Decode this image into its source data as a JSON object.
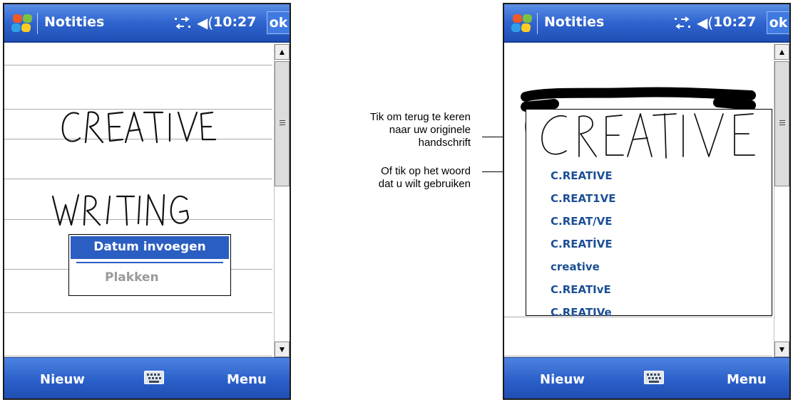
{
  "device_left": {
    "title": "Notities",
    "time": "10:27",
    "ok_label": "ok",
    "context_menu": {
      "items": [
        {
          "label": "Datum invoegen",
          "state": "active"
        },
        {
          "label": "Plakken",
          "state": "disabled"
        }
      ]
    },
    "menubar": {
      "left_label": "Nieuw",
      "right_label": "Menu"
    }
  },
  "device_right": {
    "title": "Notities",
    "time": "10:27",
    "ok_label": "ok",
    "alternatives": [
      "C.REATIVE",
      "C.REAT1VE",
      "C.REAT/VE",
      "C.REATİVE",
      "creative",
      "C.REATIvE",
      "C.REATIVe"
    ],
    "menubar": {
      "left_label": "Nieuw",
      "right_label": "Menu"
    }
  },
  "callouts": [
    {
      "lines": [
        "Tik om terug te keren",
        "naar uw originele",
        "handschrift"
      ]
    },
    {
      "lines": [
        "Of tik op het woord",
        "dat u wilt gebruiken"
      ]
    }
  ],
  "colors": {
    "titlebar": "#2f64cf",
    "menu_highlight": "#2b5ec2",
    "alternative_text": "#1c4f95",
    "disabled_text": "#9a9a9a"
  },
  "icons": {
    "start": "windows-flag-icon",
    "connectivity": "connectivity-arrows-icon",
    "volume": "speaker-icon",
    "input_panel": "keyboard-icon"
  }
}
